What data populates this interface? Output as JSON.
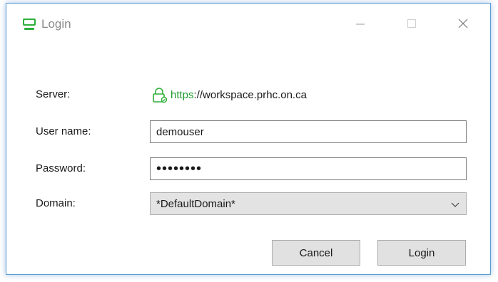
{
  "window": {
    "title": "Login"
  },
  "form": {
    "server_label": "Server:",
    "server_scheme": "https",
    "server_rest": "://workspace.prhc.on.ca",
    "username_label": "User name:",
    "username_value": "demouser",
    "password_label": "Password:",
    "password_value": "••••••••",
    "domain_label": "Domain:",
    "domain_value": "*DefaultDomain*"
  },
  "buttons": {
    "cancel_label": "Cancel",
    "login_label": "Login"
  },
  "icons": {
    "app": "monitor-icon",
    "minimize": "minimize-icon",
    "maximize": "maximize-icon",
    "close": "close-icon",
    "lock": "lock-icon",
    "dropdown": "chevron-down-icon"
  },
  "colors": {
    "accent": "#2fae3a",
    "https": "#1f9a2e",
    "window_border": "#5b9bd5"
  }
}
